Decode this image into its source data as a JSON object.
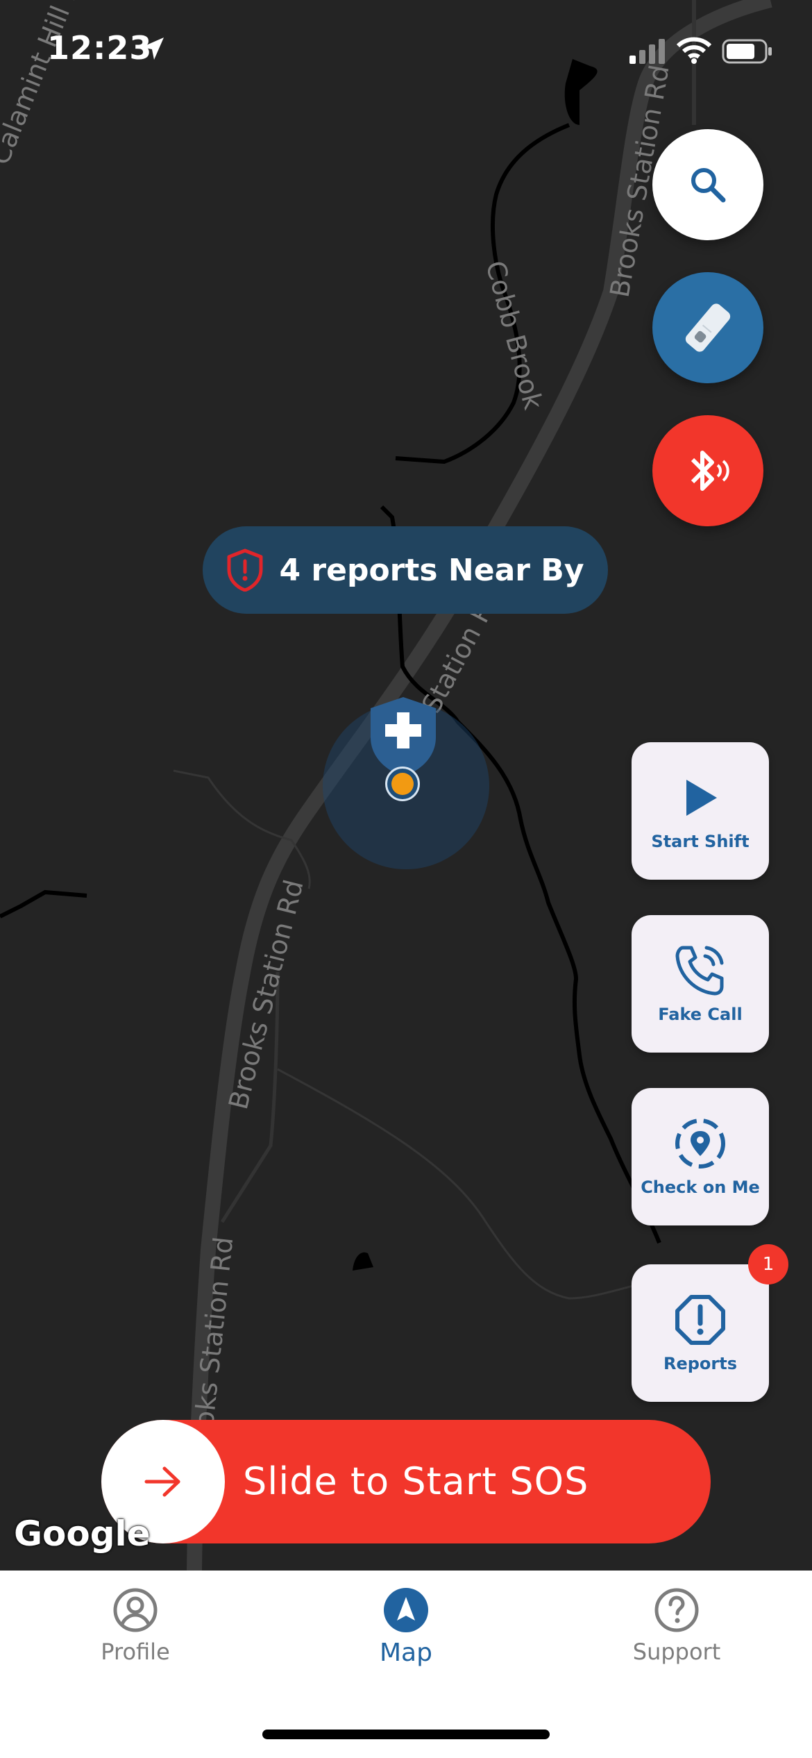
{
  "status_bar": {
    "time": "12:23"
  },
  "map": {
    "road_labels": {
      "calamint": "Calamint Hill Rd N",
      "brooks_top": "Brooks Station Rd",
      "cobb_brook": "Cobb Brook",
      "brooks_mid": "Station Rd",
      "brooks_lower": "Brooks Station Rd",
      "brooks_bottom": "Brooks Station Rd"
    },
    "attribution": "Google"
  },
  "reports_banner": {
    "text": "4 reports Near By"
  },
  "actions": {
    "start_shift": "Start Shift",
    "fake_call": "Fake Call",
    "check_on_me": "Check on Me",
    "reports": "Reports",
    "reports_badge": "1"
  },
  "sos": {
    "label": "Slide to Start SOS"
  },
  "nav": {
    "profile": "Profile",
    "map": "Map",
    "support": "Support",
    "active": "Map"
  },
  "colors": {
    "accent": "#2163a0",
    "danger": "#f2362b",
    "map_bg": "#242424",
    "card_bg": "#f3eff6"
  }
}
